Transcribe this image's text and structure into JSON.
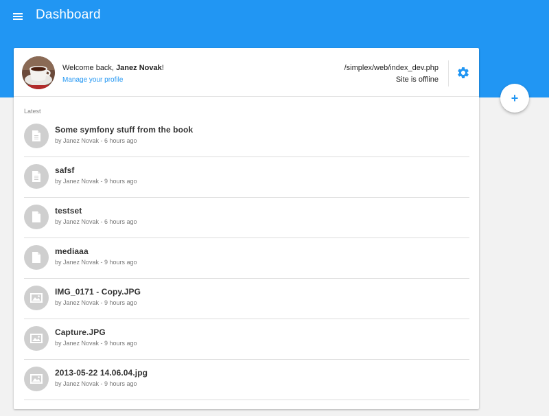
{
  "header": {
    "title": "Dashboard",
    "menu_icon": "hamburger-menu-icon"
  },
  "profile": {
    "welcome_prefix": "Welcome back, ",
    "user_name": "Janez Novak",
    "welcome_suffix": "!",
    "manage_label": "Manage your profile",
    "avatar_icon": "coffee-cup-avatar"
  },
  "site": {
    "path": "/simplex/web/index_dev.php",
    "status": "Site is offline",
    "settings_icon": "gear-icon"
  },
  "latest": {
    "label": "Latest",
    "items": [
      {
        "title": "Some symfony stuff from the book",
        "meta": "by Janez Novak - 6 hours ago",
        "icon": "document-icon"
      },
      {
        "title": "safsf",
        "meta": "by Janez Novak - 9 hours ago",
        "icon": "document-icon"
      },
      {
        "title": "testset",
        "meta": "by Janez Novak - 6 hours ago",
        "icon": "page-icon"
      },
      {
        "title": "mediaaa",
        "meta": "by Janez Novak - 9 hours ago",
        "icon": "page-icon"
      },
      {
        "title": "IMG_0171 - Copy.JPG",
        "meta": "by Janez Novak - 9 hours ago",
        "icon": "image-icon"
      },
      {
        "title": "Capture.JPG",
        "meta": "by Janez Novak - 9 hours ago",
        "icon": "image-icon"
      },
      {
        "title": "2013-05-22 14.06.04.jpg",
        "meta": "by Janez Novak - 9 hours ago",
        "icon": "image-icon"
      }
    ]
  },
  "fab": {
    "label": "+",
    "icon": "plus-icon"
  },
  "colors": {
    "primary": "#2196f3",
    "background": "#f2f2f2",
    "icon_circle": "#cfcfcf"
  }
}
